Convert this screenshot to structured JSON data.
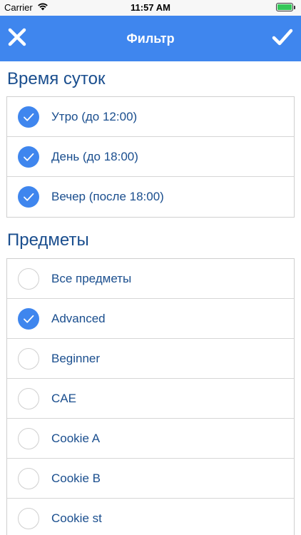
{
  "status_bar": {
    "carrier": "Carrier",
    "time": "11:57 AM",
    "battery_level": 1.0
  },
  "nav": {
    "title": "Фильтр",
    "close_icon": "close-icon",
    "confirm_icon": "checkmark-icon"
  },
  "colors": {
    "accent": "#3f86ee",
    "text": "#1a4e8e"
  },
  "time_section": {
    "title": "Время суток",
    "items": [
      {
        "label": "Утро (до 12:00)",
        "checked": true
      },
      {
        "label": "День (до 18:00)",
        "checked": true
      },
      {
        "label": "Вечер (после 18:00)",
        "checked": true
      }
    ]
  },
  "subjects_section": {
    "title": "Предметы",
    "items": [
      {
        "label": "Все предметы",
        "checked": false
      },
      {
        "label": "Advanced",
        "checked": true
      },
      {
        "label": "Beginner",
        "checked": false
      },
      {
        "label": "CAE",
        "checked": false
      },
      {
        "label": "Cookie A",
        "checked": false
      },
      {
        "label": "Cookie B",
        "checked": false
      },
      {
        "label": "Cookie st",
        "checked": false
      }
    ]
  }
}
